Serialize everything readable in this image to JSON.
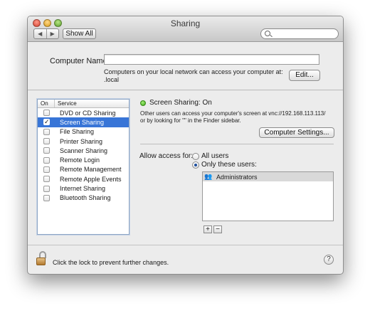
{
  "window": {
    "title": "Sharing"
  },
  "toolbar": {
    "back_glyph": "◀",
    "forward_glyph": "▶",
    "show_all_label": "Show All",
    "search_placeholder": ""
  },
  "computer": {
    "name_label": "Computer Name:",
    "name_value": "",
    "note_line1": "Computers on your local network can access your computer at:",
    "note_line2": ".local",
    "edit_label": "Edit..."
  },
  "services": {
    "header_on": "On",
    "header_service": "Service",
    "items": [
      {
        "label": "DVD or CD Sharing",
        "checked": false,
        "selected": false
      },
      {
        "label": "Screen Sharing",
        "checked": true,
        "selected": true
      },
      {
        "label": "File Sharing",
        "checked": false,
        "selected": false
      },
      {
        "label": "Printer Sharing",
        "checked": false,
        "selected": false
      },
      {
        "label": "Scanner Sharing",
        "checked": false,
        "selected": false
      },
      {
        "label": "Remote Login",
        "checked": false,
        "selected": false
      },
      {
        "label": "Remote Management",
        "checked": false,
        "selected": false
      },
      {
        "label": "Remote Apple Events",
        "checked": false,
        "selected": false
      },
      {
        "label": "Internet Sharing",
        "checked": false,
        "selected": false
      },
      {
        "label": "Bluetooth Sharing",
        "checked": false,
        "selected": false
      }
    ]
  },
  "detail": {
    "status_title": "Screen Sharing: On",
    "status_color": "#3aa617",
    "desc_line1": "Other users can access your computer's screen at vnc://192.168.113.113/",
    "desc_line2": "or by looking for \"\" in the Finder sidebar.",
    "computer_settings_label": "Computer Settings...",
    "access_label": "Allow access for:",
    "radio_all_label": "All users",
    "radio_only_label": "Only these users:",
    "selected_option": "only",
    "users": [
      "Administrators"
    ],
    "add_label": "+",
    "remove_label": "−"
  },
  "footer": {
    "lock_text": "Click the lock to prevent further changes.",
    "help_label": "?"
  },
  "colors": {
    "selection": "#3875d7",
    "window_bg": "#ececec"
  }
}
